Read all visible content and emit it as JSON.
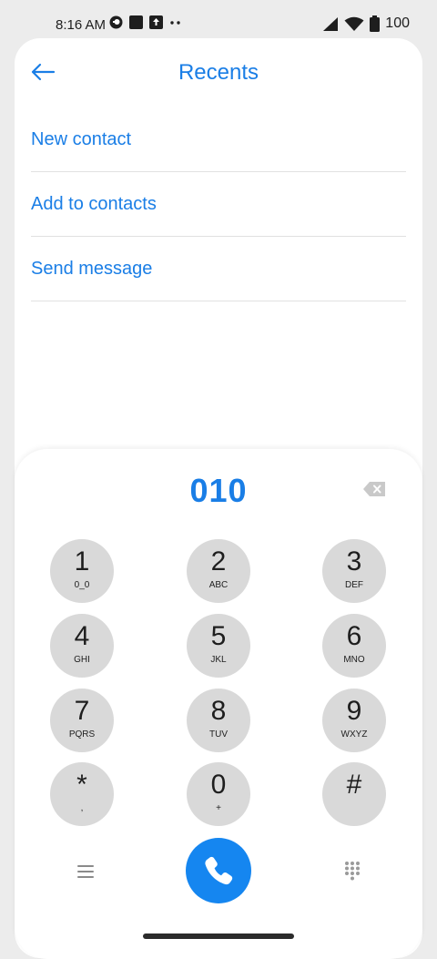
{
  "status_bar": {
    "time": "8:16 AM",
    "battery": "100",
    "left_icons": [
      "vpn-key-icon",
      "square-notification-icon",
      "upload-notification-icon",
      "more-dots-icon"
    ],
    "right_icons": [
      "signal-icon",
      "wifi-icon",
      "battery-icon"
    ]
  },
  "header": {
    "title": "Recents",
    "back_icon": "back-arrow-icon"
  },
  "menu": {
    "items": [
      {
        "label": "New contact"
      },
      {
        "label": "Add to contacts"
      },
      {
        "label": "Send message"
      }
    ]
  },
  "dialer": {
    "number": "010",
    "backspace_icon": "backspace-icon",
    "keys": [
      {
        "digit": "1",
        "letters": "0_0"
      },
      {
        "digit": "2",
        "letters": "ABC"
      },
      {
        "digit": "3",
        "letters": "DEF"
      },
      {
        "digit": "4",
        "letters": "GHI"
      },
      {
        "digit": "5",
        "letters": "JKL"
      },
      {
        "digit": "6",
        "letters": "MNO"
      },
      {
        "digit": "7",
        "letters": "PQRS"
      },
      {
        "digit": "8",
        "letters": "TUV"
      },
      {
        "digit": "9",
        "letters": "WXYZ"
      },
      {
        "digit": "*",
        "letters": ","
      },
      {
        "digit": "0",
        "letters": "+"
      },
      {
        "digit": "#",
        "letters": ""
      }
    ],
    "bottom_icons": [
      "menu-list-icon",
      "phone-icon",
      "dialpad-icon"
    ]
  },
  "colors": {
    "accent": "#1a7ee6",
    "call_button": "#1586f0",
    "key_background": "#d9d9d9",
    "card_background": "#ffffff",
    "page_background": "#ececec"
  }
}
